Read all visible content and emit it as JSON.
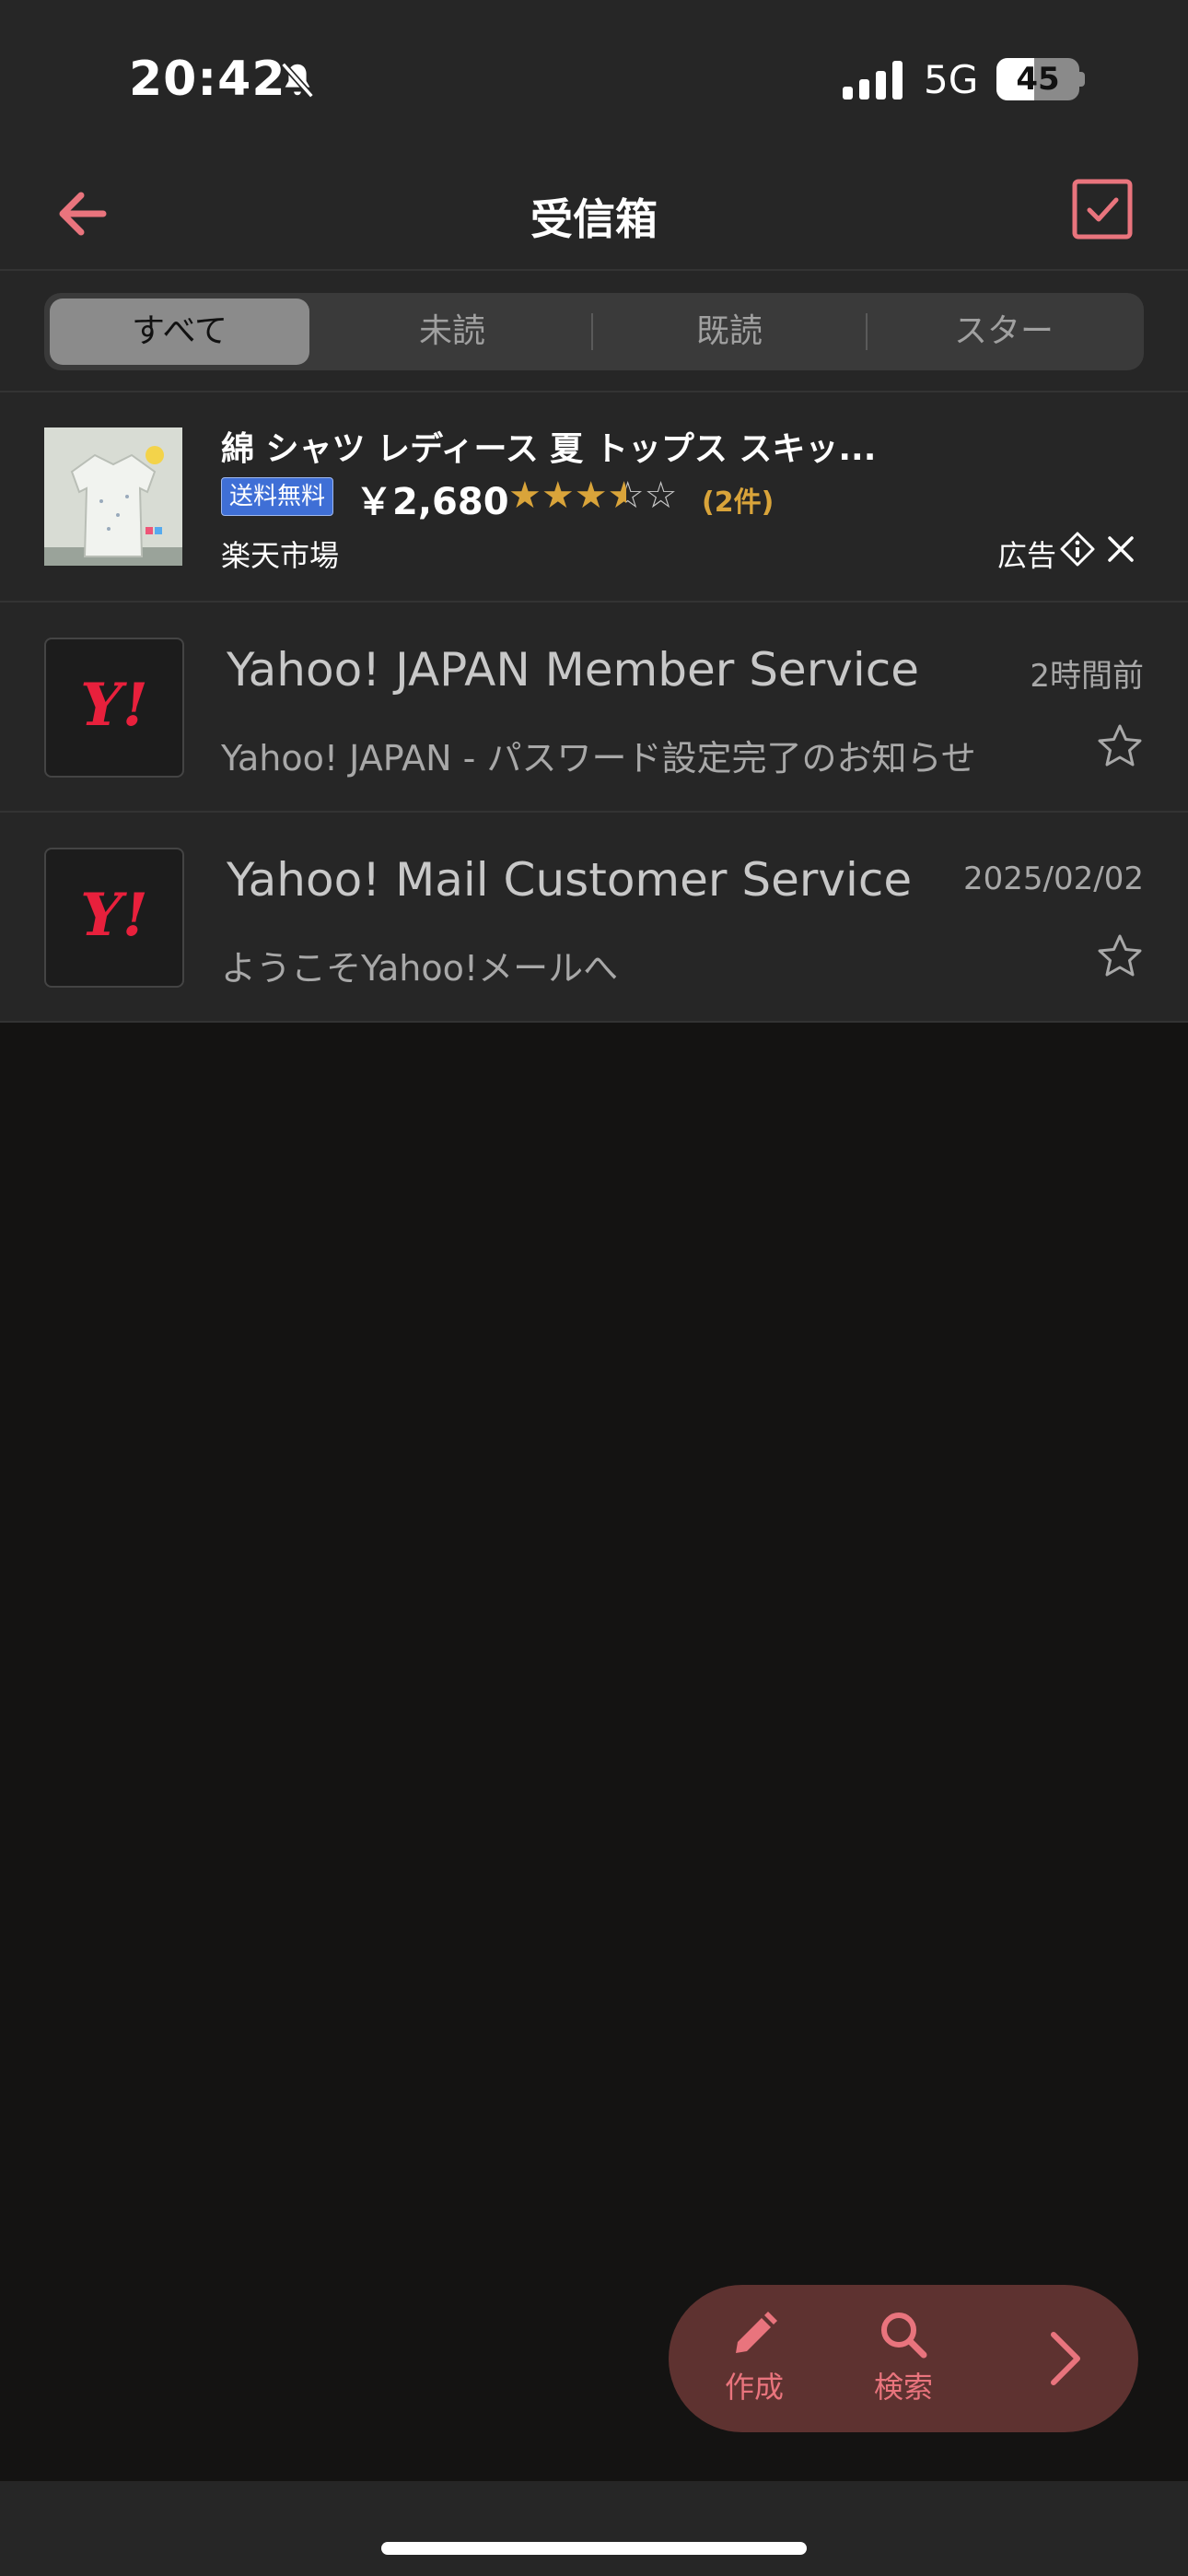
{
  "status_bar": {
    "time": "20:42",
    "network": "5G",
    "battery": "45",
    "battery_level": 0.45
  },
  "nav": {
    "title": "受信箱"
  },
  "filters": [
    {
      "label": "すべて",
      "active": true
    },
    {
      "label": "未読",
      "active": false
    },
    {
      "label": "既読",
      "active": false
    },
    {
      "label": "スター",
      "active": false
    }
  ],
  "ad": {
    "title": "綿 シャツ レディース 夏 トップス スキッ...",
    "badge": "送料無料",
    "price": "￥2,680",
    "rating": 3.5,
    "stars": "★★★",
    "half_star": "★",
    "empty_star": "☆",
    "review_count": "(2件)",
    "shop": "楽天市場",
    "label": "広告"
  },
  "mails": [
    {
      "avatar": "Y!",
      "sender": "Yahoo! JAPAN Member Service",
      "date": "2時間前",
      "subject": "Yahoo! JAPAN - パスワード設定完了のお知らせ"
    },
    {
      "avatar": "Y!",
      "sender": "Yahoo! Mail Customer Service",
      "date": "2025/02/02",
      "subject": "ようこそYahoo!メールへ"
    }
  ],
  "fab": {
    "compose": "作成",
    "search": "検索"
  },
  "colors": {
    "accent": "#e9747d",
    "background": "#141312",
    "surface": "#262626",
    "yahoo_red": "#e8203c"
  },
  "icons": [
    "bell-slash-icon",
    "signal-icon",
    "back-arrow-icon",
    "checkbox-icon",
    "info-icon",
    "close-icon",
    "star-outline-icon",
    "pencil-icon",
    "search-icon",
    "chevron-right-icon"
  ]
}
